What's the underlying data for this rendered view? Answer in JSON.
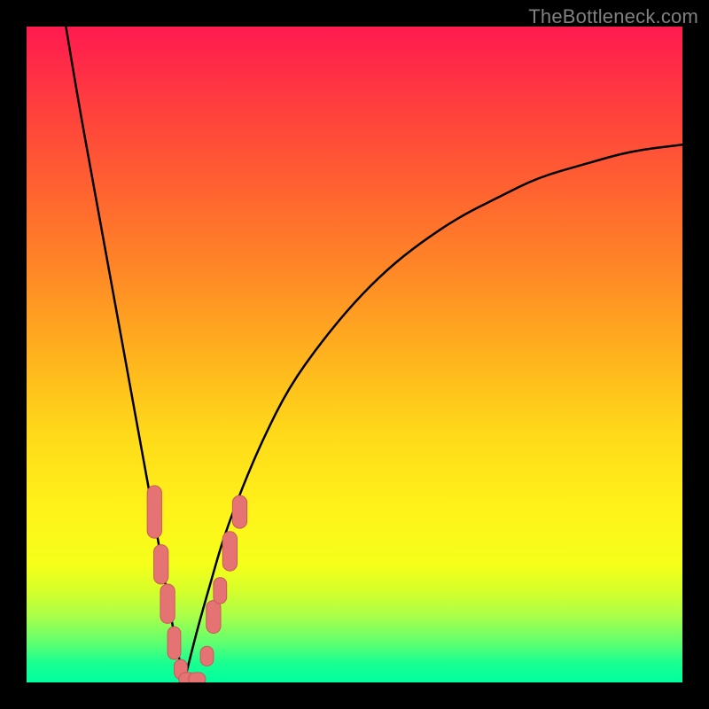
{
  "attribution": "TheBottleneck.com",
  "colors": {
    "frame": "#000000",
    "curve": "#000000",
    "marker_fill": "#e57373",
    "marker_stroke": "#c85a5a",
    "gradient_top": "#ff1a50",
    "gradient_bottom": "#00ffa0"
  },
  "chart_data": {
    "type": "line",
    "title": "",
    "xlabel": "",
    "ylabel": "",
    "xlim": [
      0,
      100
    ],
    "ylim": [
      0,
      100
    ],
    "grid": false,
    "legend": false,
    "series": [
      {
        "name": "left-branch",
        "x": [
          6,
          8,
          10,
          12,
          14,
          16,
          18,
          20,
          21,
          22,
          23,
          24
        ],
        "y": [
          100,
          88,
          77,
          66,
          55,
          44,
          33,
          22,
          16,
          10,
          5,
          0
        ]
      },
      {
        "name": "right-branch",
        "x": [
          24,
          26,
          28,
          30,
          33,
          36,
          40,
          45,
          50,
          55,
          60,
          66,
          72,
          78,
          85,
          92,
          100
        ],
        "y": [
          0,
          8,
          15,
          22,
          30,
          37,
          45,
          52,
          58,
          63,
          67,
          71,
          74,
          77,
          79,
          81,
          82
        ]
      }
    ],
    "markers": {
      "name": "highlighted-points",
      "shape": "rounded-rect",
      "points": [
        {
          "x": 19.5,
          "y": 26,
          "w": 2.2,
          "h": 8
        },
        {
          "x": 20.5,
          "y": 18,
          "w": 2.2,
          "h": 6
        },
        {
          "x": 21.5,
          "y": 12,
          "w": 2.2,
          "h": 6
        },
        {
          "x": 22.5,
          "y": 6,
          "w": 2.0,
          "h": 5
        },
        {
          "x": 23.5,
          "y": 2,
          "w": 2.0,
          "h": 3
        },
        {
          "x": 24.5,
          "y": 0.5,
          "w": 2.6,
          "h": 2
        },
        {
          "x": 26.0,
          "y": 0.5,
          "w": 2.6,
          "h": 2
        },
        {
          "x": 27.5,
          "y": 4,
          "w": 2.0,
          "h": 3
        },
        {
          "x": 28.5,
          "y": 10,
          "w": 2.2,
          "h": 5
        },
        {
          "x": 29.5,
          "y": 14,
          "w": 2.0,
          "h": 4
        },
        {
          "x": 31.0,
          "y": 20,
          "w": 2.2,
          "h": 6
        },
        {
          "x": 32.5,
          "y": 26,
          "w": 2.2,
          "h": 5
        }
      ]
    }
  }
}
